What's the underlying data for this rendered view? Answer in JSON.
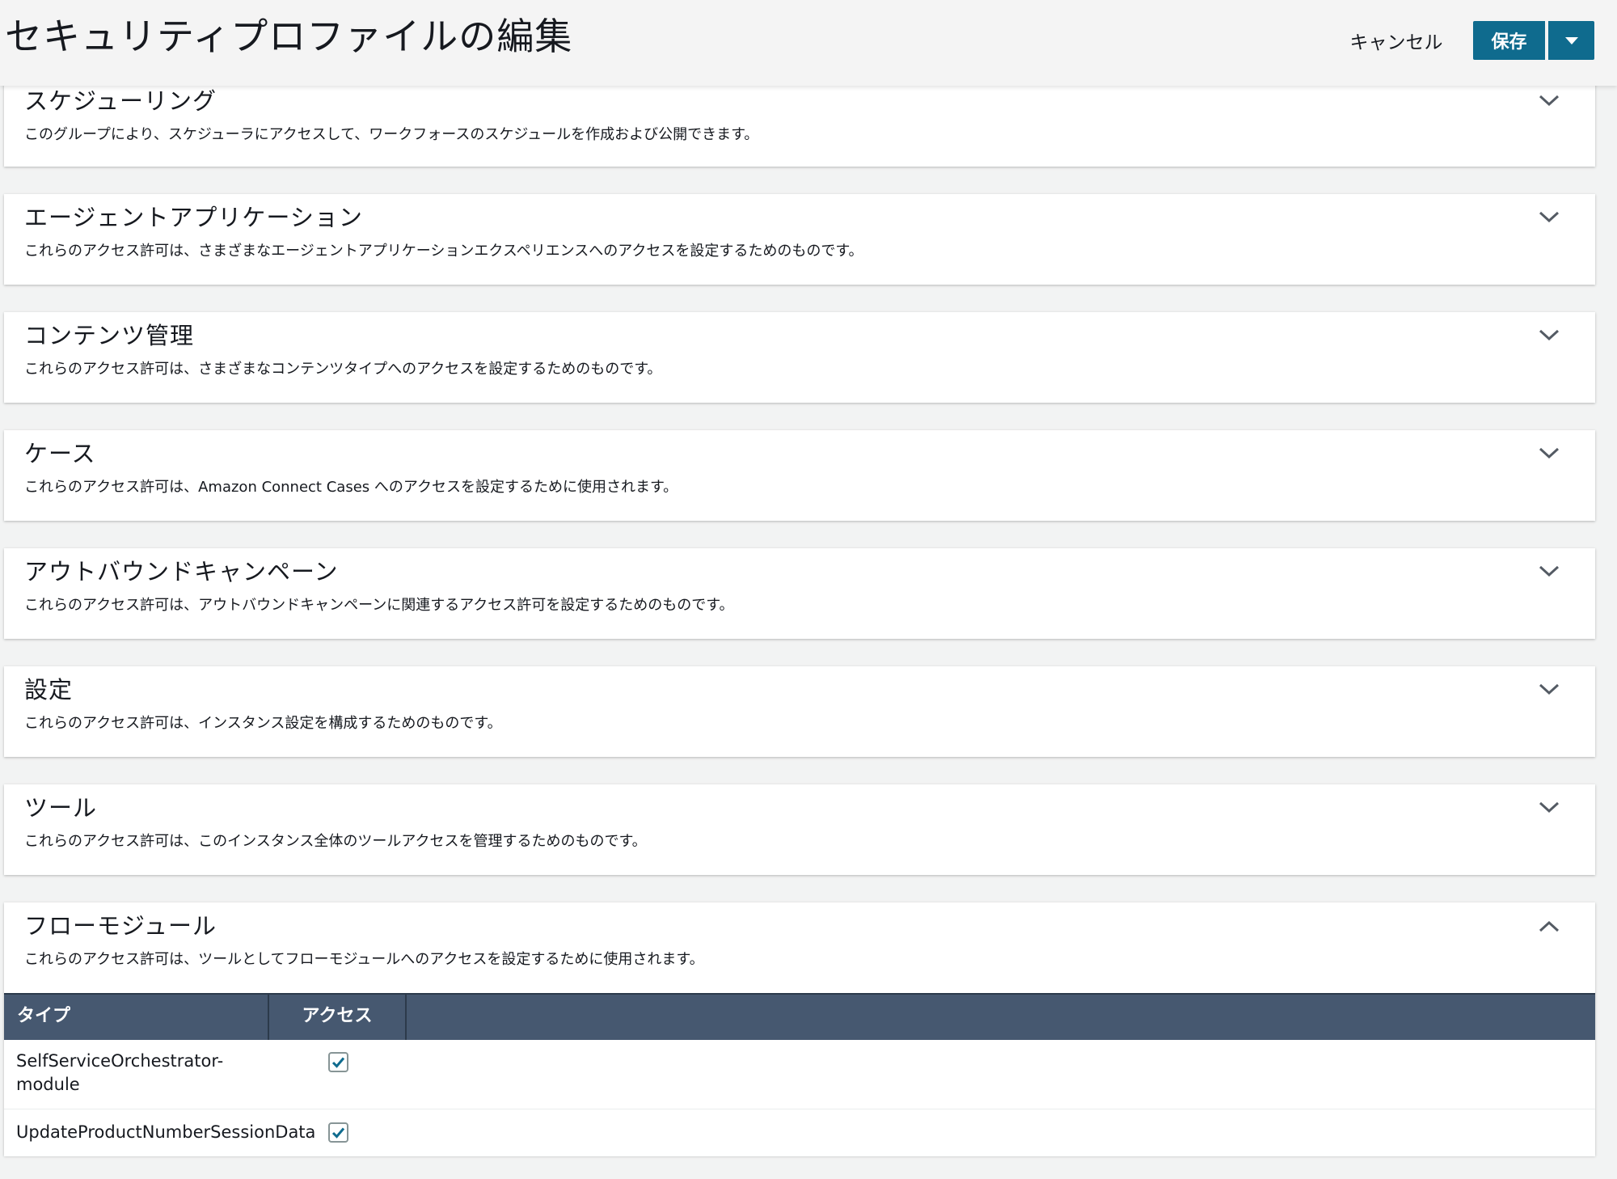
{
  "header": {
    "title": "セキュリティプロファイルの編集",
    "cancel_label": "キャンセル",
    "save_label": "保存"
  },
  "sections": [
    {
      "id": "scheduling",
      "title": "スケジューリング",
      "description": "このグループにより、スケジューラにアクセスして、ワークフォースのスケジュールを作成および公開できます。",
      "expanded": false
    },
    {
      "id": "agent-applications",
      "title": "エージェントアプリケーション",
      "description": "これらのアクセス許可は、さまざまなエージェントアプリケーションエクスペリエンスへのアクセスを設定するためのものです。",
      "expanded": false
    },
    {
      "id": "content-management",
      "title": "コンテンツ管理",
      "description": "これらのアクセス許可は、さまざまなコンテンツタイプへのアクセスを設定するためのものです。",
      "expanded": false
    },
    {
      "id": "cases",
      "title": "ケース",
      "description": "これらのアクセス許可は、Amazon Connect Cases へのアクセスを設定するために使用されます。",
      "expanded": false
    },
    {
      "id": "outbound-campaigns",
      "title": "アウトバウンドキャンペーン",
      "description": "これらのアクセス許可は、アウトバウンドキャンペーンに関連するアクセス許可を設定するためのものです。",
      "expanded": false
    },
    {
      "id": "settings",
      "title": "設定",
      "description": "これらのアクセス許可は、インスタンス設定を構成するためのものです。",
      "expanded": false
    },
    {
      "id": "tools",
      "title": "ツール",
      "description": "これらのアクセス許可は、このインスタンス全体のツールアクセスを管理するためのものです。",
      "expanded": false
    },
    {
      "id": "flow-modules",
      "title": "フローモジュール",
      "description": "これらのアクセス許可は、ツールとしてフローモジュールへのアクセスを設定するために使用されます。",
      "expanded": true
    }
  ],
  "flow_modules_table": {
    "columns": [
      "タイプ",
      "アクセス"
    ],
    "rows": [
      {
        "type": "SelfServiceOrchestrator-module",
        "access": true
      },
      {
        "type": "UpdateProductNumberSessionData",
        "access": true
      }
    ]
  },
  "colors": {
    "primary_button": "#0f6b8e",
    "table_header": "#465870",
    "background": "#f2f3f3"
  }
}
